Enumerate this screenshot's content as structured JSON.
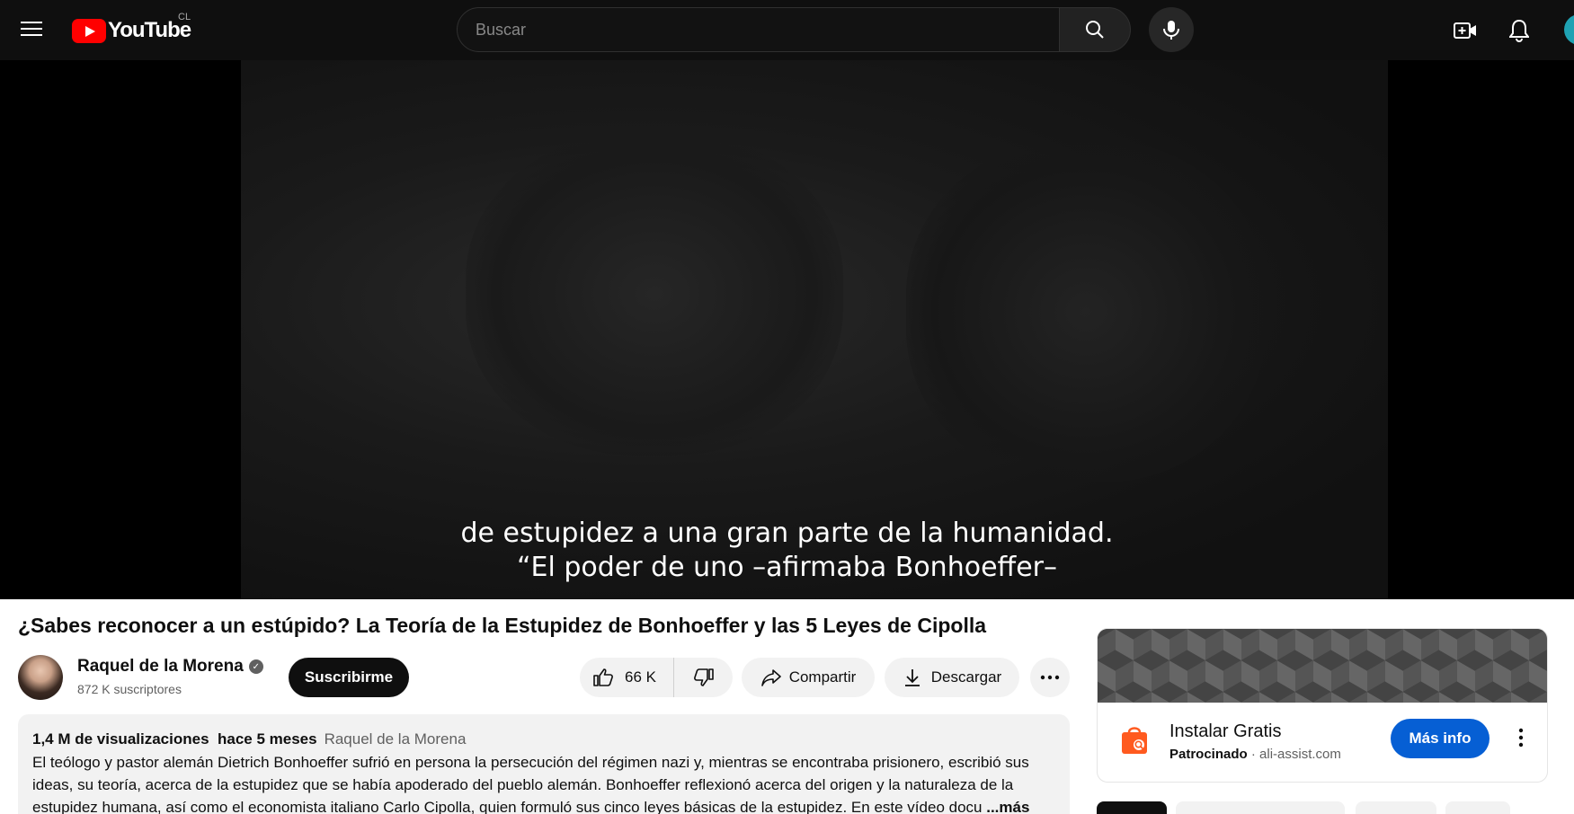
{
  "header": {
    "logo_text": "YouTube",
    "country_code": "CL",
    "search_placeholder": "Buscar"
  },
  "player": {
    "caption_line1": "de estupidez a una gran parte de la humanidad.",
    "caption_line2": "“El poder de uno –afirmaba Bonhoeffer–"
  },
  "video": {
    "title": "¿Sabes reconocer a un estúpido? La Teoría de la Estupidez de Bonhoeffer y las 5 Leyes de Cipolla",
    "channel_name": "Raquel de la Morena",
    "subscribers": "872 K suscriptores",
    "subscribe_label": "Suscribirme",
    "likes": "66 K",
    "share_label": "Compartir",
    "download_label": "Descargar"
  },
  "description": {
    "views": "1,4 M de visualizaciones",
    "age": "hace 5 meses",
    "channel_link": "Raquel de la Morena",
    "line1": "El teólogo y pastor alemán Dietrich Bonhoeffer sufrió en persona la persecución del régimen nazi y, mientras se encontraba prisionero, escribió sus",
    "line2": "ideas, su teoría, acerca de la estupidez que se había apoderado del pueblo alemán. Bonhoeffer reflexionó acerca del origen y la naturaleza de la",
    "line3": "estupidez humana, así como el economista italiano Carlo Cipolla, quien formuló sus cinco leyes básicas de la estupidez. En este vídeo docu",
    "more_label": "...más"
  },
  "ad": {
    "title": "Instalar Gratis",
    "sponsored": "Patrocinado",
    "domain": "ali-assist.com",
    "cta": "Más info"
  },
  "colors": {
    "topbar_bg": "#0f0f0f",
    "brand_red": "#ff0000",
    "cta_blue": "#065fd4"
  }
}
